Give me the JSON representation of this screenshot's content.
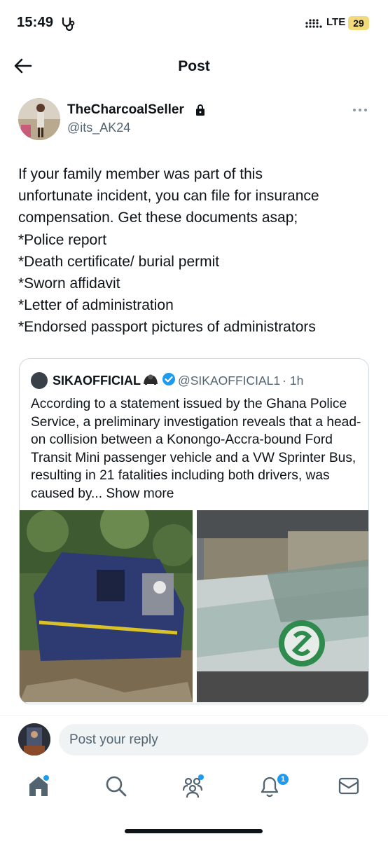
{
  "status_bar": {
    "time": "15:49",
    "network": "LTE",
    "battery": "29"
  },
  "header": {
    "title": "Post"
  },
  "post": {
    "display_name": "TheCharcoalSeller",
    "handle": "@its_AK24",
    "text": "If your family member was part of this\nunfortunate incident, you can file for insurance\ncompensation. Get these documents asap;\n*Police report\n*Death certificate/ burial permit\n*Sworn affidavit\n*Letter of administration\n*Endorsed passport pictures of administrators"
  },
  "quoted_post": {
    "display_name": "SIKAOFFICIAL",
    "handle": "@SIKAOFFICIAL1",
    "time": "· 1h",
    "text": "According to a statement issued by the Ghana Police Service, a preliminary investigation reveals that a head-on collision between a Konongo-Accra-bound Ford Transit Mini passenger vehicle and a VW Sprinter Bus, resulting in 21 fatalities including both drivers, was caused by...",
    "show_more": "Show more"
  },
  "reply_bar": {
    "placeholder": "Post your reply"
  },
  "tabs": [
    {
      "icon": "home-icon",
      "badge_dot": true
    },
    {
      "icon": "search-icon"
    },
    {
      "icon": "communities-icon",
      "badge_dot": true
    },
    {
      "icon": "notifications-icon",
      "badge": "1"
    },
    {
      "icon": "messages-icon"
    }
  ],
  "colors": {
    "accent": "#1d9bf0",
    "text": "#0f1419",
    "secondary": "#536471",
    "battery": "#f2d97a"
  }
}
